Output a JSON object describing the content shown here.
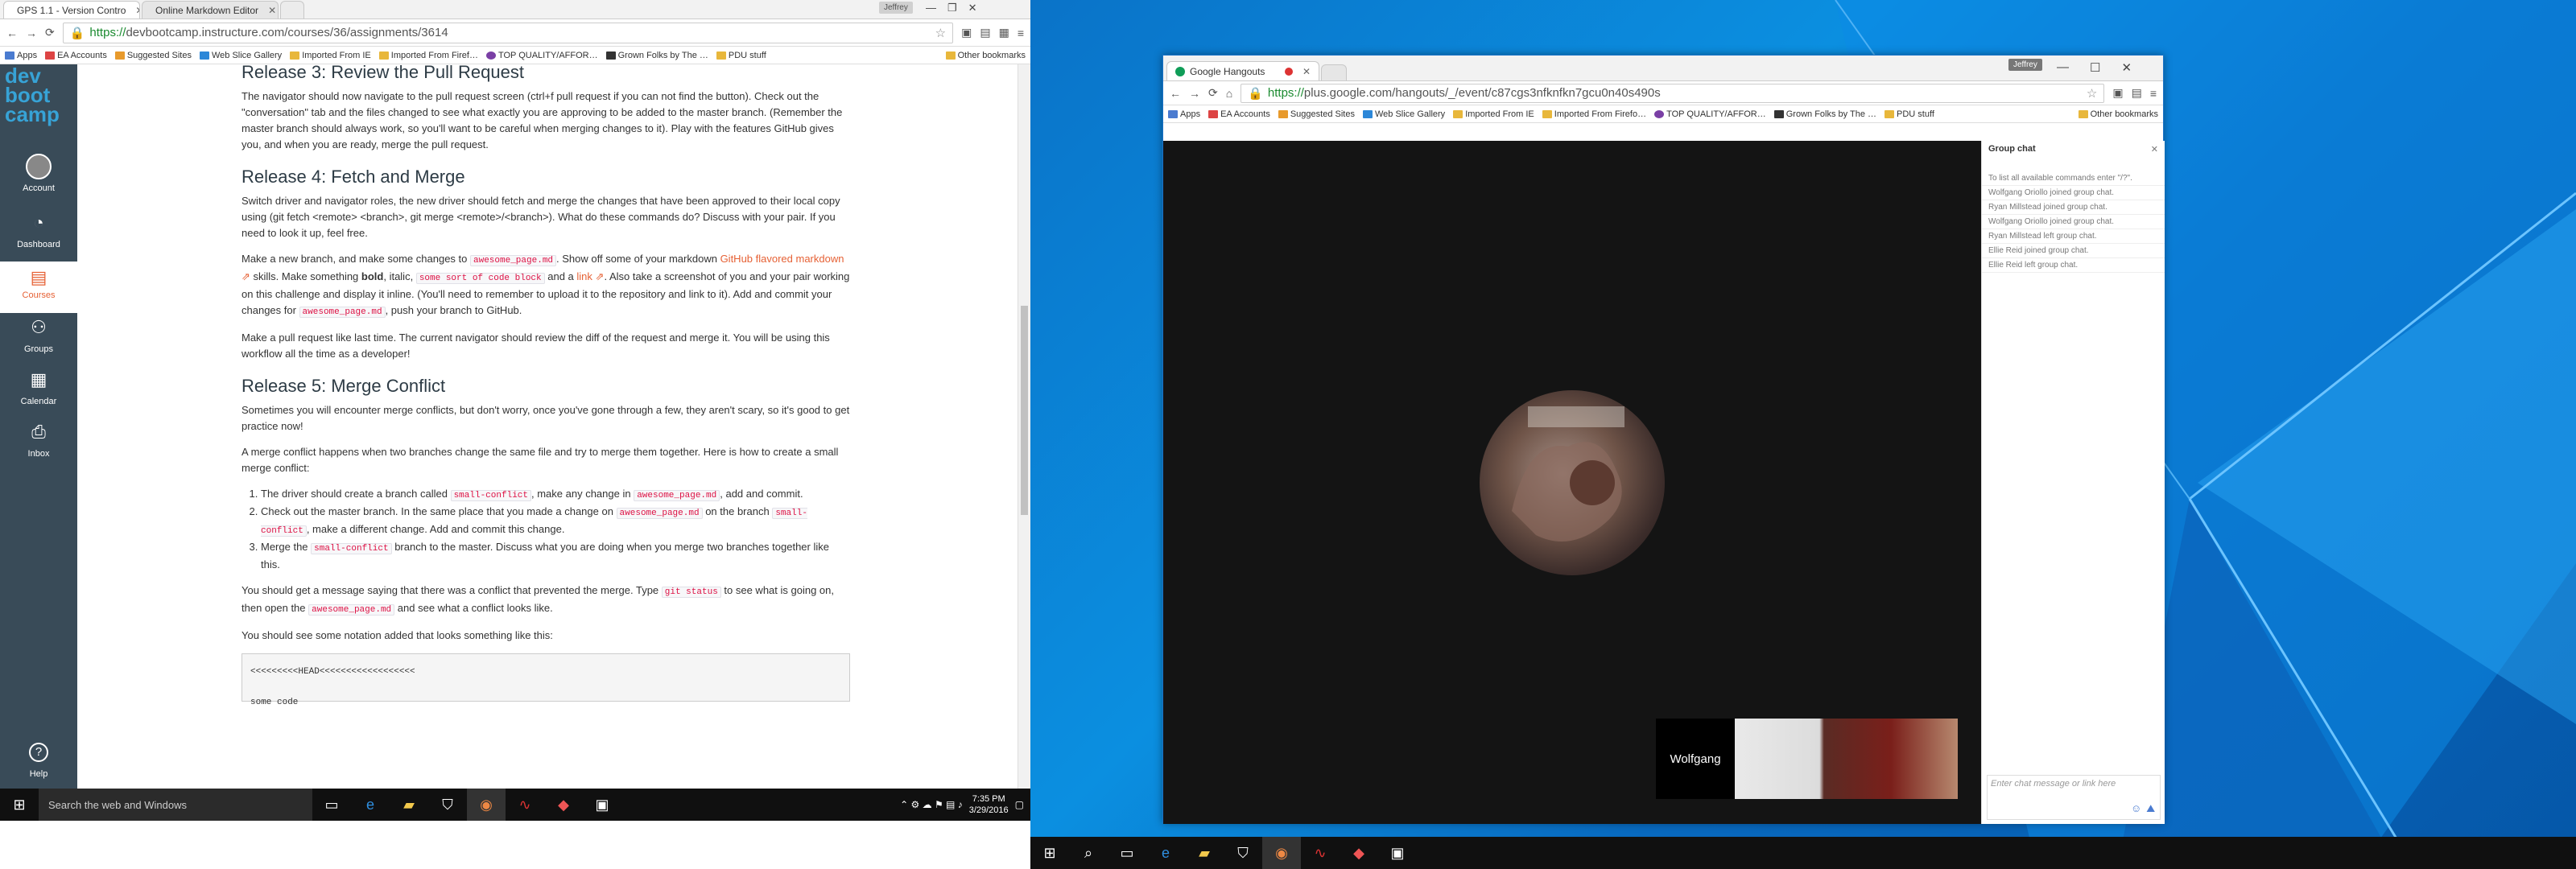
{
  "left_browser": {
    "tabs": [
      {
        "title": "GPS 1.1 - Version Contro"
      },
      {
        "title": "Online Markdown Editor"
      }
    ],
    "user_badge": "Jeffrey",
    "url_scheme": "https://",
    "url_rest": "devbootcamp.instructure.com/courses/36/assignments/3614",
    "bookmarks": [
      "Apps",
      "EA Accounts",
      "Suggested Sites",
      "Web Slice Gallery",
      "Imported From IE",
      "Imported From Firef…",
      "TOP QUALITY/AFFOR…",
      "Grown Folks by The …",
      "PDU stuff"
    ],
    "other_bookmarks": "Other bookmarks"
  },
  "canvas_nav": {
    "logo": [
      "dev",
      "boot",
      "camp"
    ],
    "items": [
      {
        "label": "Account",
        "icon": "account-icon"
      },
      {
        "label": "Dashboard",
        "icon": "dashboard-icon"
      },
      {
        "label": "Courses",
        "icon": "courses-icon"
      },
      {
        "label": "Groups",
        "icon": "groups-icon"
      },
      {
        "label": "Calendar",
        "icon": "calendar-icon"
      },
      {
        "label": "Inbox",
        "icon": "inbox-icon"
      },
      {
        "label": "Help",
        "icon": "help-icon"
      }
    ]
  },
  "doc": {
    "r3_title": "Release 3: Review the Pull Request",
    "r3_p1": "The navigator should now navigate to the pull request screen (ctrl+f pull request if you can not find the button). Check out the \"conversation\" tab and the files changed to see what exactly you are approving to be added to the master branch. (Remember the master branch should always work, so you'll want to be careful when merging changes to it). Play with the features GitHub gives you, and when you are ready, merge the pull request.",
    "r4_title": "Release 4: Fetch and Merge",
    "r4_p1": "Switch driver and navigator roles, the new driver should fetch and merge the changes that have been approved to their local copy using (git fetch <remote> <branch>, git merge <remote>/<branch>). What do these commands do? Discuss with your pair. If you need to look it up, feel free.",
    "r4_p2_a": "Make a new branch, and make some changes to ",
    "r4_p2_code1": "awesome_page.md",
    "r4_p2_b": ". Show off some of your markdown ",
    "r4_p2_link1": "GitHub flavored markdown",
    "r4_p2_c": " skills. Make something ",
    "r4_p2_bold": "bold",
    "r4_p2_d": ", italic, ",
    "r4_p2_code2": "some sort of code block",
    "r4_p2_e": " and a ",
    "r4_p2_link2": "link",
    "r4_p2_f": ". Also take a screenshot of you and your pair working on this challenge and display it inline. (You'll need to remember to upload it to the repository and link to it). Add and commit your changes for ",
    "r4_p2_code3": "awesome_page.md",
    "r4_p2_g": ", push your branch to GitHub.",
    "r4_p3": "Make a pull request like last time. The current navigator should review the diff of the request and merge it. You will be using this workflow all the time as a developer!",
    "r5_title": "Release 5: Merge Conflict",
    "r5_p1": "Sometimes you will encounter merge conflicts, but don't worry, once you've gone through a few, they aren't scary, so it's good to get practice now!",
    "r5_p2": "A merge conflict happens when two branches change the same file and try to merge them together. Here is how to create a small merge conflict:",
    "li1_a": "The driver should create a branch called ",
    "li1_code": "small-conflict",
    "li1_b": ", make any change in ",
    "li1_code2": "awesome_page.md",
    "li1_c": ", add and commit.",
    "li2_a": "Check out the master branch. In the same place that you made a change on ",
    "li2_code": "awesome_page.md",
    "li2_b": " on the branch ",
    "li2_code2": "small-conflict",
    "li2_c": ", make a different change. Add and commit this change.",
    "li3_a": "Merge the ",
    "li3_code": "small-conflict",
    "li3_b": " branch to the master. Discuss what you are doing when you merge two branches together like this.",
    "r5_p3_a": "You should get a message saying that there was a conflict that prevented the merge. Type ",
    "r5_p3_code": "git status",
    "r5_p3_b": " to see what is going on, then open the ",
    "r5_p3_code2": "awesome_page.md",
    "r5_p3_c": " and see what a conflict looks like.",
    "r5_p4": "You should see some notation added that looks something like this:",
    "pre_line1": "<<<<<<<<<HEAD<<<<<<<<<<<<<<<<<<",
    "pre_line2": "some code"
  },
  "taskbar_left": {
    "search_placeholder": "Search the web and Windows",
    "time": "7:35 PM",
    "date": "3/29/2016"
  },
  "hangouts": {
    "tab_title": "Google Hangouts",
    "user_badge": "Jeffrey",
    "url_scheme": "https://",
    "url_rest": "plus.google.com/hangouts/_/event/c87cgs3nfknfkn7gcu0n40s490s",
    "bookmarks": [
      "Apps",
      "EA Accounts",
      "Suggested Sites",
      "Web Slice Gallery",
      "Imported From IE",
      "Imported From Firefo…",
      "TOP QUALITY/AFFOR…",
      "Grown Folks by The …",
      "PDU stuff"
    ],
    "other_bookmarks": "Other bookmarks",
    "chat_title": "Group chat",
    "chat_messages": [
      "To list all available commands enter \"/?\".",
      "Wolfgang Oriollo joined group chat.",
      "Ryan Millstead joined group chat.",
      "Wolfgang Oriollo joined group chat.",
      "Ryan Millstead left group chat.",
      "Ellie Reid joined group chat.",
      "Ellie Reid left group chat."
    ],
    "chat_placeholder": "Enter chat message or link here",
    "participant_name": "Wolfgang"
  },
  "colors": {
    "canvas_nav": "#394b58",
    "accent": "#e66135",
    "desktop": "#0a78d0"
  }
}
